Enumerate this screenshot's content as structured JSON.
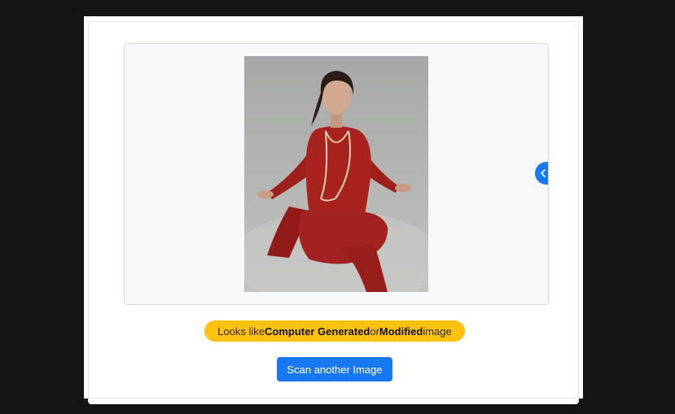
{
  "result": {
    "verdict_prefix": "Looks like ",
    "verdict_strong_1": "Computer Generated",
    "verdict_middle": " or ",
    "verdict_strong_2": "Modified",
    "verdict_suffix": " image",
    "badge_color": "#ffc20e"
  },
  "actions": {
    "scan_again_label": "Scan another Image",
    "button_color": "#1778f2"
  },
  "preview": {
    "image_subject": "woman in red outfit seated on floor",
    "side_toggle_icon": "chevron-left-icon"
  }
}
